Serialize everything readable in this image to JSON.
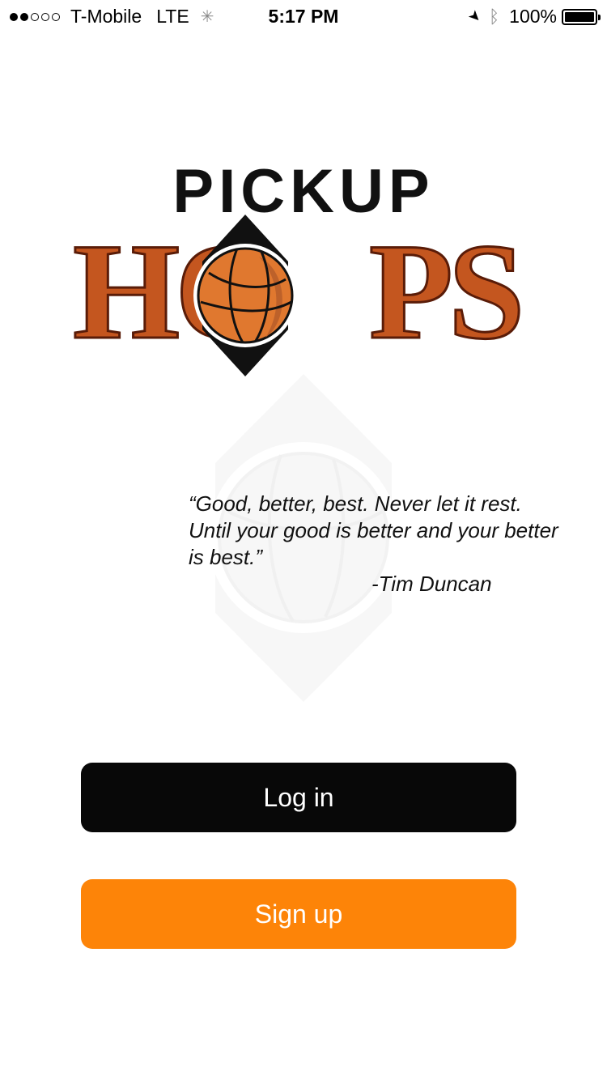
{
  "status_bar": {
    "signal_dots_filled": 2,
    "signal_dots_total": 5,
    "carrier": "T-Mobile",
    "network": "LTE",
    "time": "5:17 PM",
    "battery_percent": "100%",
    "icons": [
      "location-arrow-icon",
      "bluetooth-icon",
      "battery-icon"
    ]
  },
  "logo": {
    "line1": "PICKUP",
    "line2_left": "HO",
    "line2_right": "PS",
    "ball_icon": "basketball-icon"
  },
  "quote": {
    "text": "“Good, better, best. Never let it rest. Until your good is better and your better is best.”",
    "author": "-Tim Duncan"
  },
  "buttons": {
    "login": "Log in",
    "signup": "Sign up"
  },
  "colors": {
    "brand_orange": "#fd8408",
    "hoops_orange": "#c4561f",
    "login_bg": "#080808"
  }
}
